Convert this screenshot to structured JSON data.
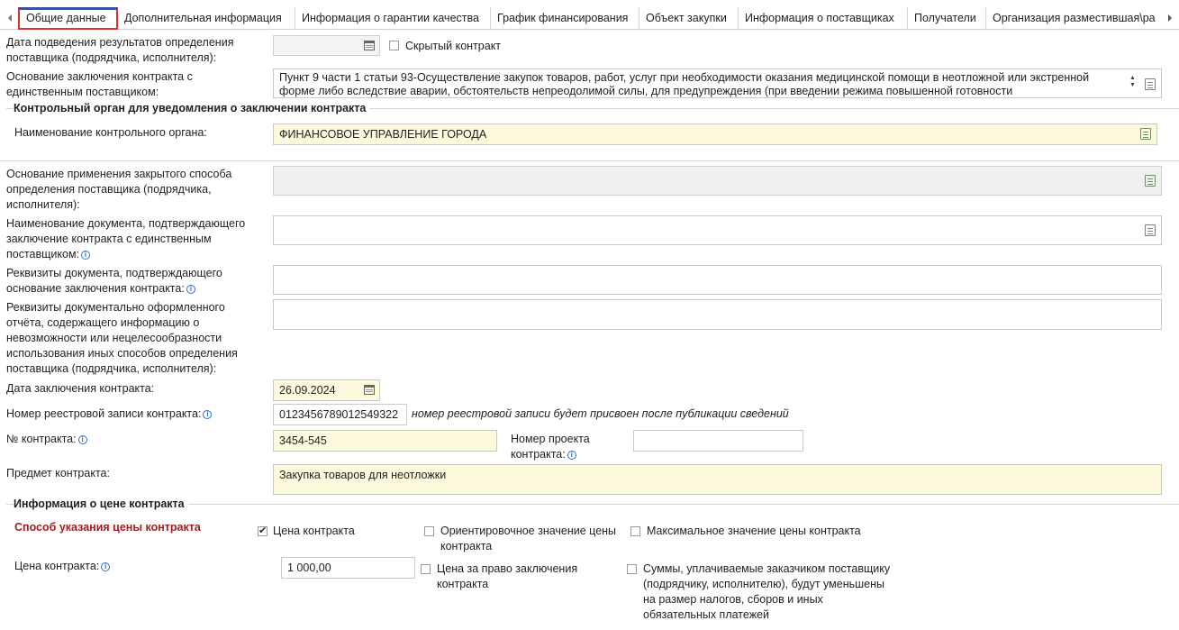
{
  "tabs": [
    {
      "label": "Общие данные"
    },
    {
      "label": "Дополнительная информация"
    },
    {
      "label": "Информация о гарантии качества"
    },
    {
      "label": "График финансирования"
    },
    {
      "label": "Объект закупки"
    },
    {
      "label": "Информация о поставщиках"
    },
    {
      "label": "Получатели"
    },
    {
      "label": "Организация разместившая\\ра"
    }
  ],
  "form": {
    "results_date_label": "Дата подведения результатов определения поставщика (подрядчика, исполнителя):",
    "results_date_value": "",
    "hidden_contract_label": "Скрытый контракт",
    "basis_label": "Основание заключения контракта с единственным поставщиком:",
    "basis_value": "Пункт 9 части 1 статьи 93-Осуществление закупок товаров, работ, услуг при необходимости оказания медицинской помощи в неотложной или экстренной форме либо вследствие аварии, обстоятельств непреодолимой силы, для предупреждения (при введении режима повышенной готовности",
    "control_section_title": "Контрольный орган для уведомления о заключении контракта",
    "control_name_label": "Наименование контрольного органа:",
    "control_name_value": "ФИНАНСОВОЕ УПРАВЛЕНИЕ ГОРОДА",
    "closed_method_label": "Основание применения закрытого способа определения поставщика (подрядчика, исполнителя):",
    "closed_method_value": "",
    "doc_name_label": "Наименование документа, подтверждающего заключение контракта с единственным поставщиком:",
    "doc_name_value": "",
    "doc_req_label": "Реквизиты документа, подтверждающего основание заключения контракта:",
    "doc_req_value": "",
    "report_req_label": "Реквизиты документально оформленного отчёта, содержащего информацию о невозможности или нецелесообразности использования иных способов определения поставщика (подрядчика, исполнителя):",
    "report_req_value": "",
    "contract_date_label": "Дата заключения контракта:",
    "contract_date_value": "26.09.2024",
    "registry_label": "Номер реестровой записи контракта:",
    "registry_value": "0123456789012549322",
    "registry_note": "номер реестровой записи будет присвоен после публикации сведений",
    "contract_no_label": "№ контракта:",
    "contract_no_value": "3454-545",
    "project_no_label": "Номер проекта контракта:",
    "project_no_value": "",
    "subject_label": "Предмет контракта:",
    "subject_value": "Закупка товаров для неотложки"
  },
  "price": {
    "section_title": "Информация о цене контракта",
    "method_title": "Способ указания цены контракта",
    "opt_price": "Цена контракта",
    "opt_estimated": "Ориентировочное значение цены контракта",
    "opt_max": "Максимальное значение цены контракта",
    "price_label": "Цена контракта:",
    "price_value": "1 000,00",
    "right_price_label": "Цена за право заключения контракта",
    "taxes_label": "Суммы, уплачиваемые заказчиком поставщику (подрядчику, исполнителю), будут уменьшены на размер налогов, сборов и иных обязательных платежей"
  }
}
